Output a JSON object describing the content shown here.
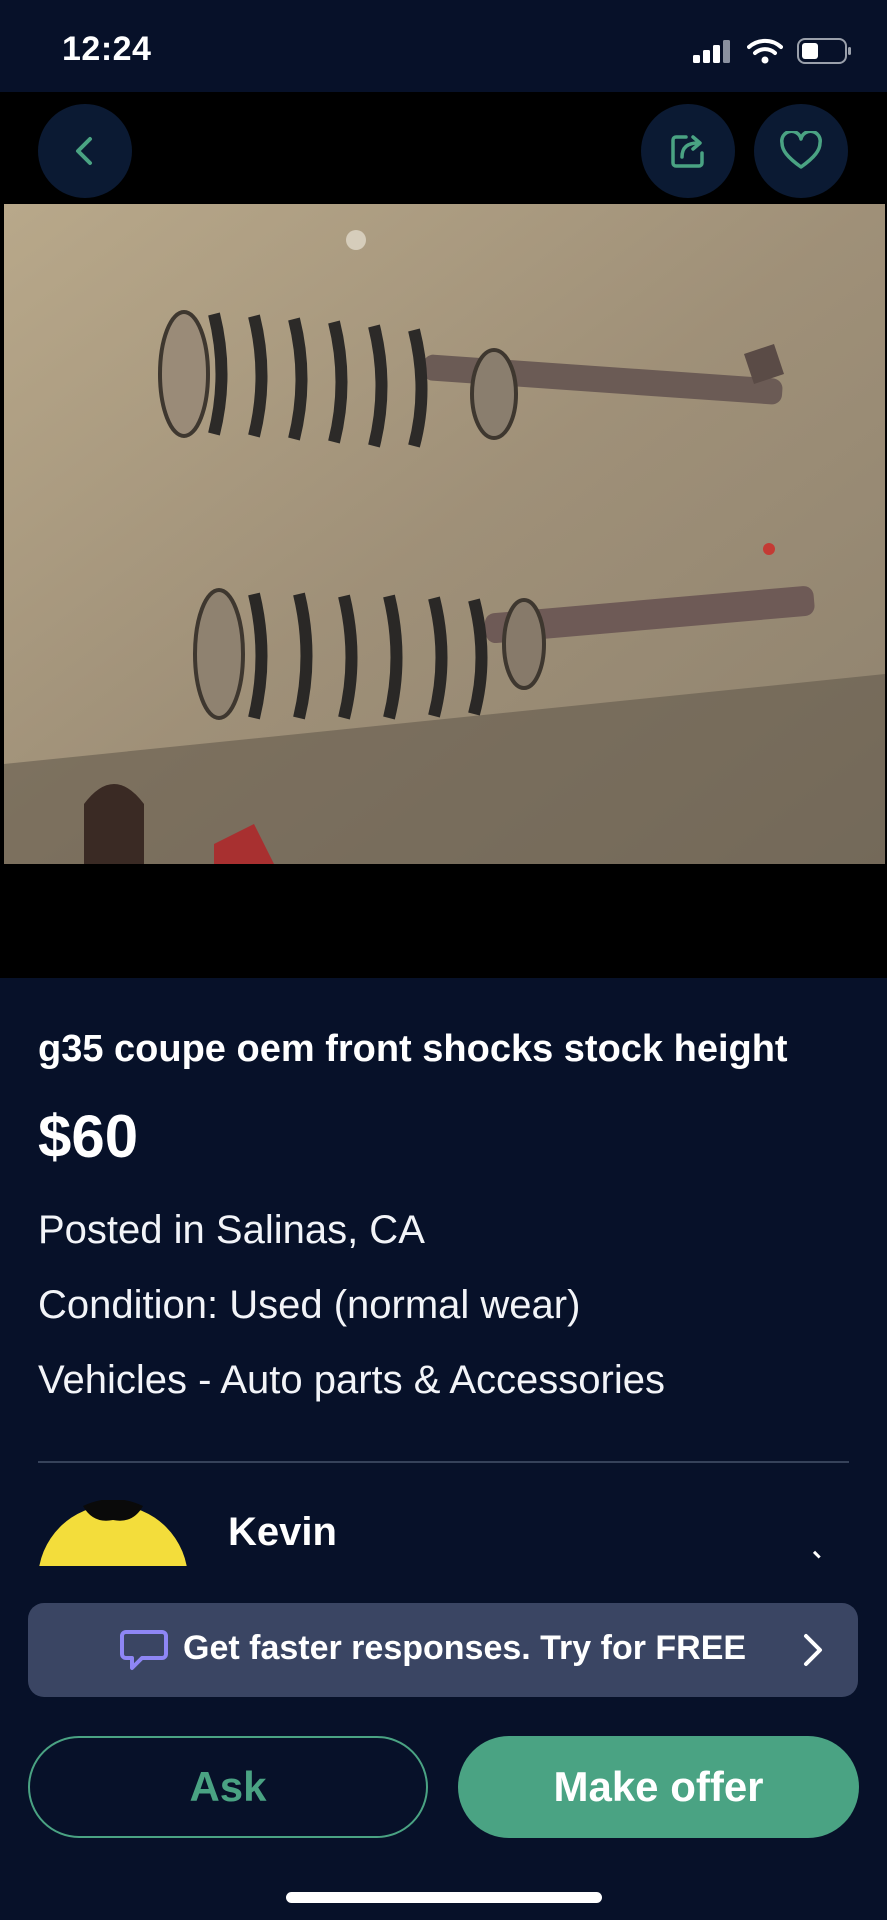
{
  "status_bar": {
    "time": "12:24"
  },
  "topbar": {
    "back_icon": "chevron-left-icon",
    "share_icon": "share-icon",
    "favorite_icon": "heart-icon"
  },
  "listing": {
    "title": "g35 coupe oem front shocks stock height",
    "price": "$60",
    "location": "Posted in Salinas, CA",
    "condition": "Condition: Used (normal wear)",
    "category": "Vehicles - Auto parts & Accessories",
    "photo_icon": "listing-photo"
  },
  "seller": {
    "name": "Kevin"
  },
  "promo": {
    "text": "Get faster responses.  Try for FREE",
    "icon": "chat-bubble-icon"
  },
  "actions": {
    "ask": "Ask",
    "make_offer": "Make offer"
  },
  "colors": {
    "background": "#071129",
    "accent": "#4aa383",
    "banner": "#3a4563"
  }
}
